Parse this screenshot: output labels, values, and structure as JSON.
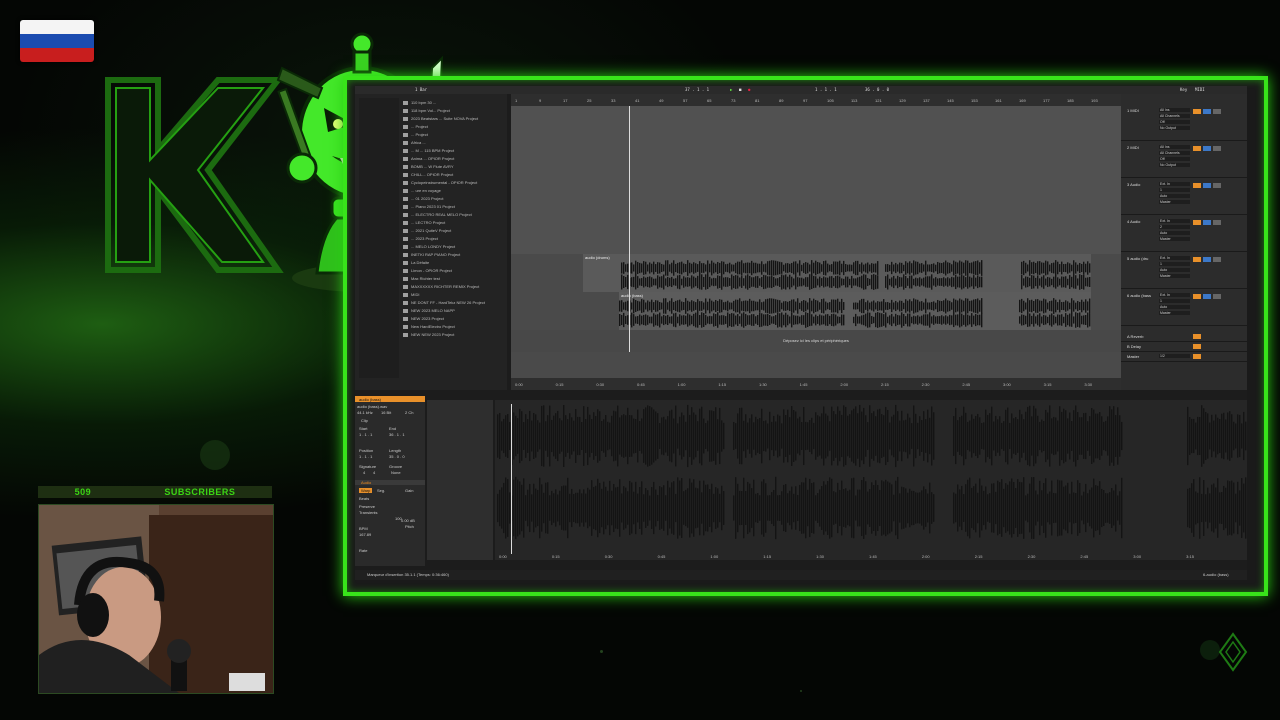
{
  "overlay": {
    "subscribers_count": "509",
    "subscribers_label": "SUBSCRIBERS"
  },
  "daw": {
    "toolbar": {
      "tempo": "1 Bar",
      "position": "37 . 1 . 1",
      "loop_start": "1 . 1 . 1",
      "loop_len": "36 . 0 . 0",
      "key_label": "Key",
      "midi_label": "MIDI"
    },
    "browser_items": [
      "110 bpm 30 ...",
      "118 bpm Vol... Project",
      "2023 Beatstars ... Suite NOVA Project",
      "... Project",
      "... Project",
      "Africa ... ",
      "... M ... 115 BPM Project",
      "Anima ... OPIOR Project",
      "BOMB ... W Flute AVRY",
      "CHILL... OPIOR Project",
      "Cyclopeinstrumental - OPIOR Project",
      "... ure en voyage",
      "... 01 2023 Project",
      "... Piano 2023 01 Project",
      "... ELECTRO REAL MELO Project",
      "... LECTRO Project",
      "... 2021 QuiteV Project",
      "... 2023 Project",
      "... MELO LONDY Project",
      "INETKI RAP PIANO Project",
      "La Défaite",
      "Limon - OPIOR Project",
      "Max Richter test",
      "MAXXXXXX RICHTER REMIX Project",
      "MIDI",
      "NE DONT FF - HardTekz NEW 26 Project",
      "NEW 2023 MELO NAPP",
      "NEW 2023 Project",
      "New HardElectro Project",
      "NEW NEW 2023 Project"
    ],
    "ruler_ticks": [
      "1",
      "9",
      "17",
      "25",
      "33",
      "41",
      "49",
      "57",
      "65",
      "73",
      "81",
      "89",
      "97",
      "105",
      "113",
      "121",
      "129",
      "137",
      "145",
      "153",
      "161",
      "169",
      "177",
      "185",
      "193"
    ],
    "time_ticks": [
      "0:00",
      "0:15",
      "0:30",
      "0:45",
      "1:00",
      "1:15",
      "1:30",
      "1:45",
      "2:00",
      "2:15",
      "2:30",
      "2:45",
      "3:00",
      "3:15",
      "3:30"
    ],
    "tracks": [
      {
        "name": "1 MIDI",
        "input": "All Ins",
        "channel": "All Channels",
        "monitor": "Off",
        "output": "No Output"
      },
      {
        "name": "2 MIDI",
        "input": "All Ins",
        "channel": "All Channels",
        "monitor": "Off",
        "output": "No Output"
      },
      {
        "name": "3 Audio",
        "input": "Ext. In",
        "channel": "1",
        "monitor": "Auto",
        "output": "Master"
      },
      {
        "name": "4 Audio",
        "input": "Ext. In",
        "channel": "2",
        "monitor": "Auto",
        "output": "Master"
      },
      {
        "name": "5 audio (dru",
        "input": "Ext. In",
        "channel": "1",
        "monitor": "Auto",
        "output": "Master"
      },
      {
        "name": "6 audio (bass",
        "input": "Ext. In",
        "channel": "1",
        "monitor": "Auto",
        "output": "Master"
      }
    ],
    "returns": [
      {
        "name": "A Reverb"
      },
      {
        "name": "B Delay"
      },
      {
        "name": "Master",
        "channel": "1/2"
      }
    ],
    "clip_labels": {
      "drums": "audio (drums)",
      "bass": "audio (bass)",
      "drop_hint": "Déposez ici les clips et périphériques"
    },
    "clip_view": {
      "title": "audio (bass)",
      "file": "audio (bass).wav",
      "sample_rate": "44.1 kHz",
      "bits": "16 Bit",
      "channels": "2 Ch",
      "clip_label": "Clip",
      "start_label": "Start",
      "end_label": "End",
      "start_value": "1 . 1 . 1",
      "end_value": "36 . 1 . 1",
      "position_label": "Position",
      "length_label": "Length",
      "position_value": "1 . 1 . 1",
      "length_value": "35 . 0 . 0",
      "signature_label": "Signature",
      "groove_label": "Groove",
      "sig_num": "4",
      "sig_den": "4",
      "groove_value": "None",
      "audio_label": "Audio",
      "warp_label": "Warp",
      "seg_label": "Seg.",
      "beats_label": "Beats",
      "preserve_label": "Preserve",
      "transients_label": "Transients",
      "gain_label": "Gain",
      "gain_value": "0.00 dB",
      "pitch_label": "Pitch",
      "bpm_label": "BPM",
      "bpm_value": "167.89",
      "percent": "100",
      "rate": "Rate"
    },
    "detail_ticks": [
      "0:00",
      "0:15",
      "0:30",
      "0:45",
      "1:00",
      "1:15",
      "1:30",
      "1:45",
      "2:00",
      "2:15",
      "2:30",
      "2:45",
      "3:00",
      "3:15"
    ],
    "status": {
      "left": "Marqueur d'insertion 35.1.1 (Temps: 0:36:460)",
      "right": "6-audio (bass)"
    }
  },
  "colors": {
    "frame_green": "#38e41a",
    "clip_orange": "#f08c1e",
    "daw_bg": "#1c1c1c"
  }
}
